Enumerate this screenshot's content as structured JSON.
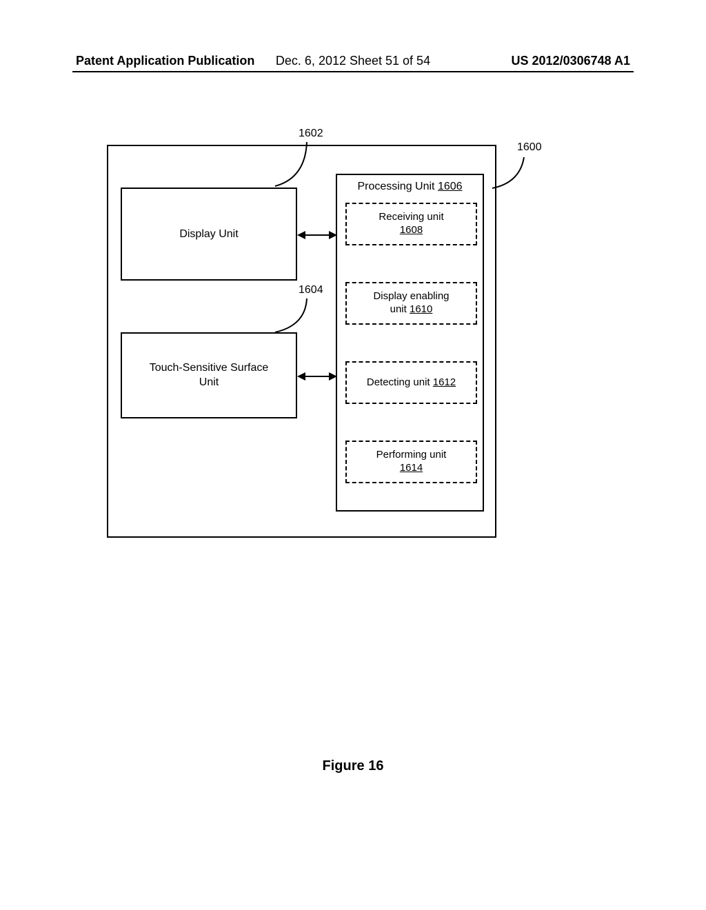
{
  "header": {
    "left": "Patent Application Publication",
    "center": "Dec. 6, 2012   Sheet 51 of 54",
    "right": "US 2012/0306748 A1"
  },
  "labels": {
    "outer_ref": "1600",
    "display_unit_ref": "1602",
    "touch_unit_ref": "1604"
  },
  "boxes": {
    "display_unit": "Display Unit",
    "touch_unit": "Touch-Sensitive Surface\nUnit",
    "processing_unit_label": "Processing Unit ",
    "processing_unit_num": "1606",
    "receiving_label": "Receiving unit",
    "receiving_num": "1608",
    "display_enabling_label": "Display enabling\nunit ",
    "display_enabling_num": "1610",
    "detecting_label": "Detecting unit ",
    "detecting_num": "1612",
    "performing_label": "Performing unit",
    "performing_num": "1614"
  },
  "caption": "Figure 16"
}
